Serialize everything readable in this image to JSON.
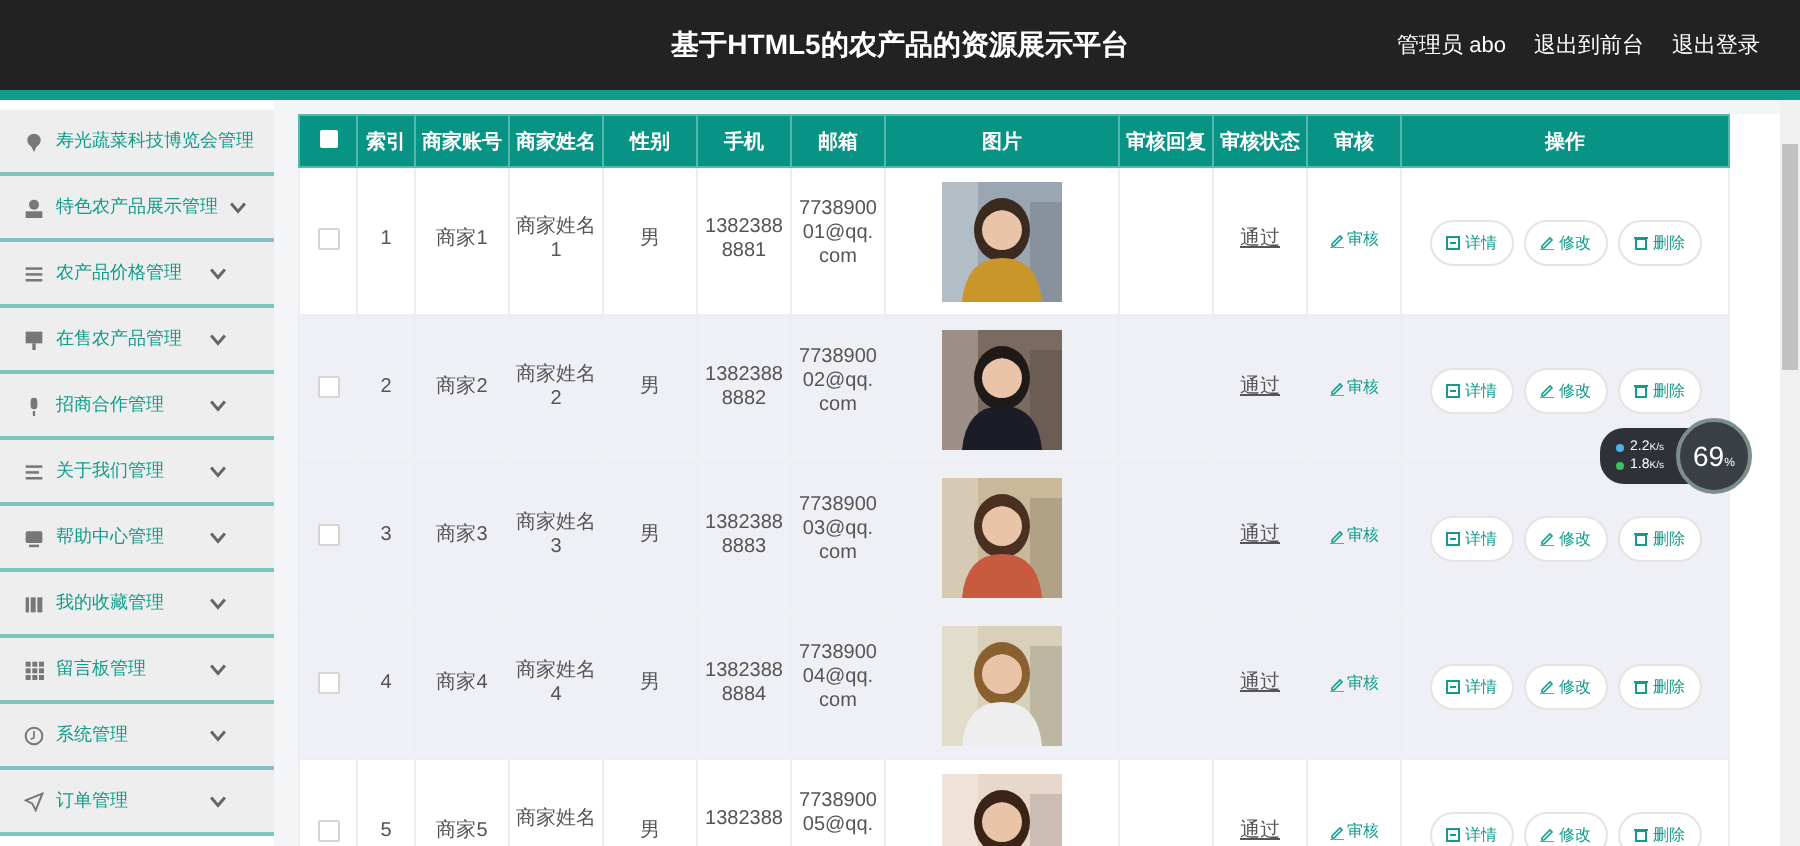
{
  "header": {
    "title": "基于HTML5的农产品的资源展示平台",
    "links": [
      "管理员 abo",
      "退出到前台",
      "退出登录"
    ]
  },
  "sidebar": {
    "items": [
      {
        "label": "寿光蔬菜科技博览会管理",
        "expandable": false
      },
      {
        "label": "特色农产品展示管理",
        "expandable": true
      },
      {
        "label": "农产品价格管理",
        "expandable": true
      },
      {
        "label": "在售农产品管理",
        "expandable": true
      },
      {
        "label": "招商合作管理",
        "expandable": true
      },
      {
        "label": "关于我们管理",
        "expandable": true
      },
      {
        "label": "帮助中心管理",
        "expandable": true
      },
      {
        "label": "我的收藏管理",
        "expandable": true
      },
      {
        "label": "留言板管理",
        "expandable": true
      },
      {
        "label": "系统管理",
        "expandable": true
      },
      {
        "label": "订单管理",
        "expandable": true
      }
    ]
  },
  "table": {
    "select_all": {
      "checked": false
    },
    "columns": [
      "索引",
      "商家账号",
      "商家姓名",
      "性别",
      "手机",
      "邮箱",
      "图片",
      "审核回复",
      "审核状态",
      "审核",
      "操作"
    ],
    "rows": [
      {
        "checked": false,
        "shaded": false,
        "index": "1",
        "account": "商家1",
        "name": "商家姓名1",
        "gender": "男",
        "phone": "13823888881",
        "email": "773890001@qq.com",
        "status": "通过",
        "review": "审核",
        "actions": [
          "详情",
          "修改",
          "删除"
        ]
      },
      {
        "checked": false,
        "shaded": true,
        "index": "2",
        "account": "商家2",
        "name": "商家姓名2",
        "gender": "男",
        "phone": "13823888882",
        "email": "773890002@qq.com",
        "status": "通过",
        "review": "审核",
        "actions": [
          "详情",
          "修改",
          "删除"
        ]
      },
      {
        "checked": false,
        "shaded": true,
        "index": "3",
        "account": "商家3",
        "name": "商家姓名3",
        "gender": "男",
        "phone": "13823888883",
        "email": "773890003@qq.com",
        "status": "通过",
        "review": "审核",
        "actions": [
          "详情",
          "修改",
          "删除"
        ]
      },
      {
        "checked": false,
        "shaded": true,
        "index": "4",
        "account": "商家4",
        "name": "商家姓名4",
        "gender": "男",
        "phone": "13823888884",
        "email": "773890004@qq.com",
        "status": "通过",
        "review": "审核",
        "actions": [
          "详情",
          "修改",
          "删除"
        ]
      },
      {
        "checked": false,
        "shaded": false,
        "index": "5",
        "account": "商家5",
        "name": "商家姓名",
        "gender": "男",
        "phone": "1382388",
        "email": "773890005@qq.",
        "status": "通过",
        "review": "审核",
        "actions": [
          "详情",
          "修改",
          "删除"
        ]
      }
    ]
  },
  "speed_widget": {
    "upload": "2.2",
    "upload_unit": "K/s",
    "download": "1.8",
    "download_unit": "K/s",
    "percent": "69",
    "percent_unit": "%"
  }
}
